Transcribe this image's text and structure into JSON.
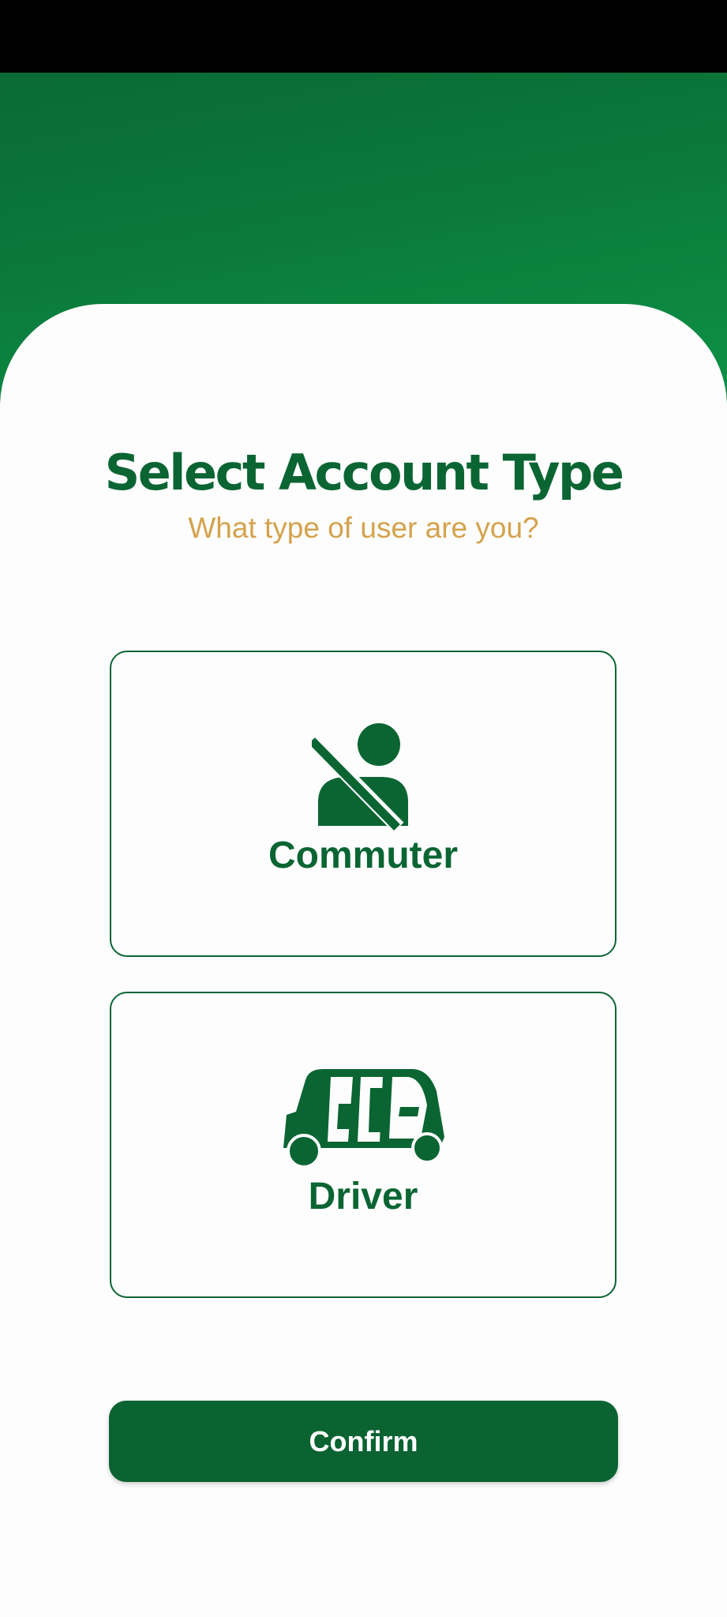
{
  "header": {
    "title": "Select Account Type",
    "subtitle": "What type of user are you?"
  },
  "options": [
    {
      "label": "Commuter",
      "icon": "seatbelt-person-icon"
    },
    {
      "label": "Driver",
      "icon": "tuk-tuk-icon"
    }
  ],
  "actions": {
    "confirm_label": "Confirm"
  },
  "colors": {
    "brand_green": "#0a6533",
    "header_gradient_light": "#10a550",
    "subtitle_gold": "#d4a24c",
    "status_bar": "#000000"
  }
}
